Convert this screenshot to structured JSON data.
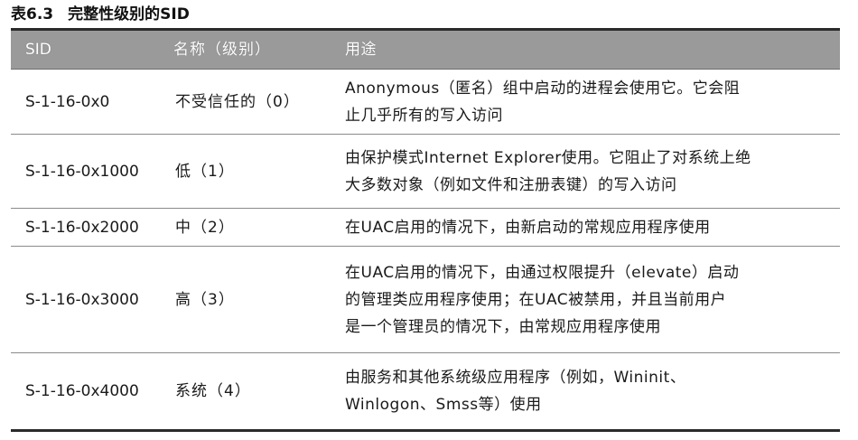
{
  "caption": {
    "number": "表6.3",
    "title": "完整性级别的SID"
  },
  "table": {
    "headers": [
      "SID",
      "名称（级别）",
      "用途"
    ],
    "rows": [
      {
        "sid": "S-1-16-0x0",
        "name": "不受信任的（0）",
        "usage_lines": [
          "Anonymous（匿名）组中启动的进程会使用它。它会阻",
          "止几乎所有的写入访问"
        ]
      },
      {
        "sid": "S-1-16-0x1000",
        "name": "低（1）",
        "usage_lines": [
          "由保护模式Internet Explorer使用。它阻止了对系统上绝",
          "大多数对象（例如文件和注册表键）的写入访问"
        ]
      },
      {
        "sid": "S-1-16-0x2000",
        "name": "中（2）",
        "usage_lines": [
          "在UAC启用的情况下，由新启动的常规应用程序使用"
        ]
      },
      {
        "sid": "S-1-16-0x3000",
        "name": "高（3）",
        "usage_lines": [
          "在UAC启用的情况下，由通过权限提升（elevate）启动",
          "的管理类应用程序使用；在UAC被禁用，并且当前用户",
          "是一个管理员的情况下，由常规应用程序使用"
        ]
      },
      {
        "sid": "S-1-16-0x4000",
        "name": "系统（4）",
        "usage_lines": [
          "由服务和其他系统级应用程序（例如，Wininit、",
          "Winlogon、Smss等）使用"
        ]
      }
    ]
  },
  "colors": {
    "header_bg": "#9a9a9a",
    "header_text": "#ffffff",
    "rule": "#2a2a2a"
  }
}
